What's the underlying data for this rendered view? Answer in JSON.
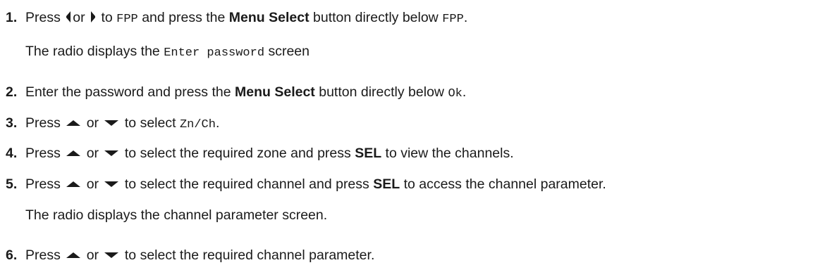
{
  "steps": [
    {
      "number": "1.",
      "w1": "Press",
      "or": "or",
      "w2": "to",
      "m1": "FPP",
      "w3": "and press the",
      "b1": "Menu Select",
      "w4": "button directly below",
      "m2": "FPP",
      "end": ".",
      "note_pre": "The radio displays the",
      "note_mono": "Enter password",
      "note_post": "screen",
      "icons": [
        "left-arrow-icon",
        "right-arrow-icon"
      ]
    },
    {
      "number": "2.",
      "t1": "Enter the password and press the",
      "b1": "Menu Select",
      "t2": "button directly below",
      "m1": "Ok",
      "end": "."
    },
    {
      "number": "3.",
      "w1": "Press",
      "or": "or",
      "t1": "to select",
      "m1": "Zn/Ch",
      "end": ".",
      "icons": [
        "up-arrow-icon",
        "down-arrow-icon"
      ]
    },
    {
      "number": "4.",
      "w1": "Press",
      "or": "or",
      "t1": "to select the required zone and press",
      "b1": "SEL",
      "t2": "to view the channels."
    },
    {
      "number": "5.",
      "w1": "Press",
      "or": "or",
      "t1": "to select the required channel and press",
      "b1": "SEL",
      "t2": "to access the channel parameter.",
      "note": "The radio displays the channel parameter screen."
    },
    {
      "number": "6.",
      "w1": "Press",
      "or": "or",
      "t1": "to select the required channel parameter."
    }
  ],
  "colors": {
    "text": "#1a1a1a",
    "icon": "#1a1a1a"
  }
}
